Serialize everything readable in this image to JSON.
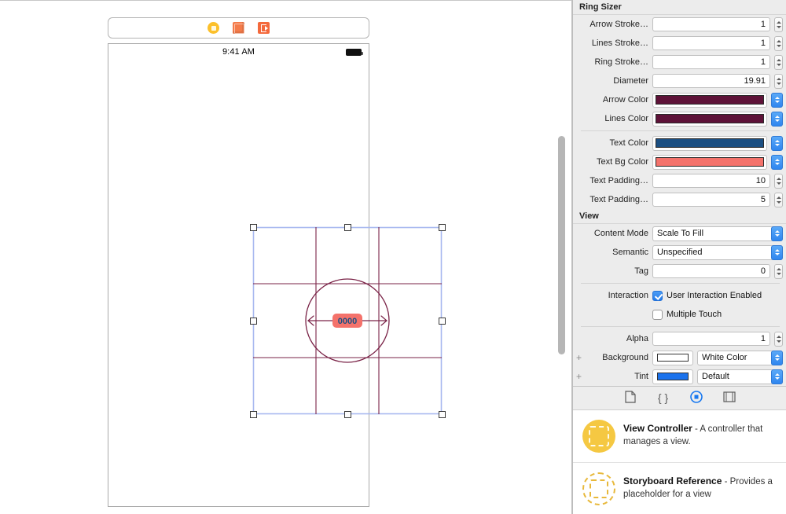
{
  "canvas": {
    "scene_dock": {
      "items": [
        {
          "name": "view-controller",
          "icon": "view-controller-icon"
        },
        {
          "name": "first-responder",
          "icon": "first-responder-icon"
        },
        {
          "name": "exit",
          "icon": "exit-icon"
        }
      ]
    },
    "device": {
      "status_time": "9:41 AM",
      "battery": "battery-icon"
    },
    "ring_view": {
      "value_label": "0000",
      "label_text_color": "#1B4F82",
      "label_bg_color": "#F4726B",
      "ring_color": "#7A2347",
      "lines_color": "#7A2347",
      "selection_color": "#A8B8F0"
    }
  },
  "inspector": {
    "sections": [
      {
        "title": "Ring Sizer",
        "rows": [
          {
            "type": "number",
            "label": "Arrow Stroke…",
            "value": "1"
          },
          {
            "type": "number",
            "label": "Lines Stroke…",
            "value": "1"
          },
          {
            "type": "number",
            "label": "Ring Stroke…",
            "value": "1"
          },
          {
            "type": "number",
            "label": "Diameter",
            "value": "19.91"
          },
          {
            "type": "color",
            "label": "Arrow Color",
            "value": "#5E1238"
          },
          {
            "type": "color",
            "label": "Lines Color",
            "value": "#5E1238"
          },
          {
            "type": "divider"
          },
          {
            "type": "color",
            "label": "Text Color",
            "value": "#1B4F82"
          },
          {
            "type": "color",
            "label": "Text Bg Color",
            "value": "#F4726B"
          },
          {
            "type": "number",
            "label": "Text Padding…",
            "value": "10"
          },
          {
            "type": "number",
            "label": "Text Padding…",
            "value": "5"
          }
        ]
      },
      {
        "title": "View",
        "rows": [
          {
            "type": "popup",
            "label": "Content Mode",
            "value": "Scale To Fill"
          },
          {
            "type": "popup",
            "label": "Semantic",
            "value": "Unspecified"
          },
          {
            "type": "number",
            "label": "Tag",
            "value": "0"
          },
          {
            "type": "divider"
          },
          {
            "type": "checkbox",
            "label": "Interaction",
            "value": "User Interaction Enabled",
            "checked": true
          },
          {
            "type": "checkbox",
            "label": "",
            "value": "Multiple Touch",
            "checked": false
          },
          {
            "type": "divider"
          },
          {
            "type": "number",
            "label": "Alpha",
            "value": "1"
          },
          {
            "type": "colorpopup",
            "label": "Background",
            "value": "White Color",
            "swatch": "#FFFFFF",
            "plus": "+"
          },
          {
            "type": "colorpopup",
            "label": "Tint",
            "value": "Default",
            "swatch": "#1B72EC",
            "plus": "+"
          }
        ]
      }
    ]
  },
  "library": {
    "tabs": [
      {
        "name": "file-template-library",
        "icon": "file-icon",
        "active": false
      },
      {
        "name": "code-snippet-library",
        "icon": "braces-icon",
        "active": false
      },
      {
        "name": "object-library",
        "icon": "circle-dot-icon",
        "active": true
      },
      {
        "name": "media-library",
        "icon": "media-icon",
        "active": false
      }
    ],
    "items": [
      {
        "title": "View Controller",
        "dash": " - ",
        "desc": "A controller that manages a view.",
        "icon": "view-controller-library-icon",
        "icon_style": "filled"
      },
      {
        "title": "Storyboard Reference",
        "dash": " - ",
        "desc": "Provides a placeholder for a view",
        "icon": "storyboard-reference-library-icon",
        "icon_style": "outline"
      }
    ]
  }
}
